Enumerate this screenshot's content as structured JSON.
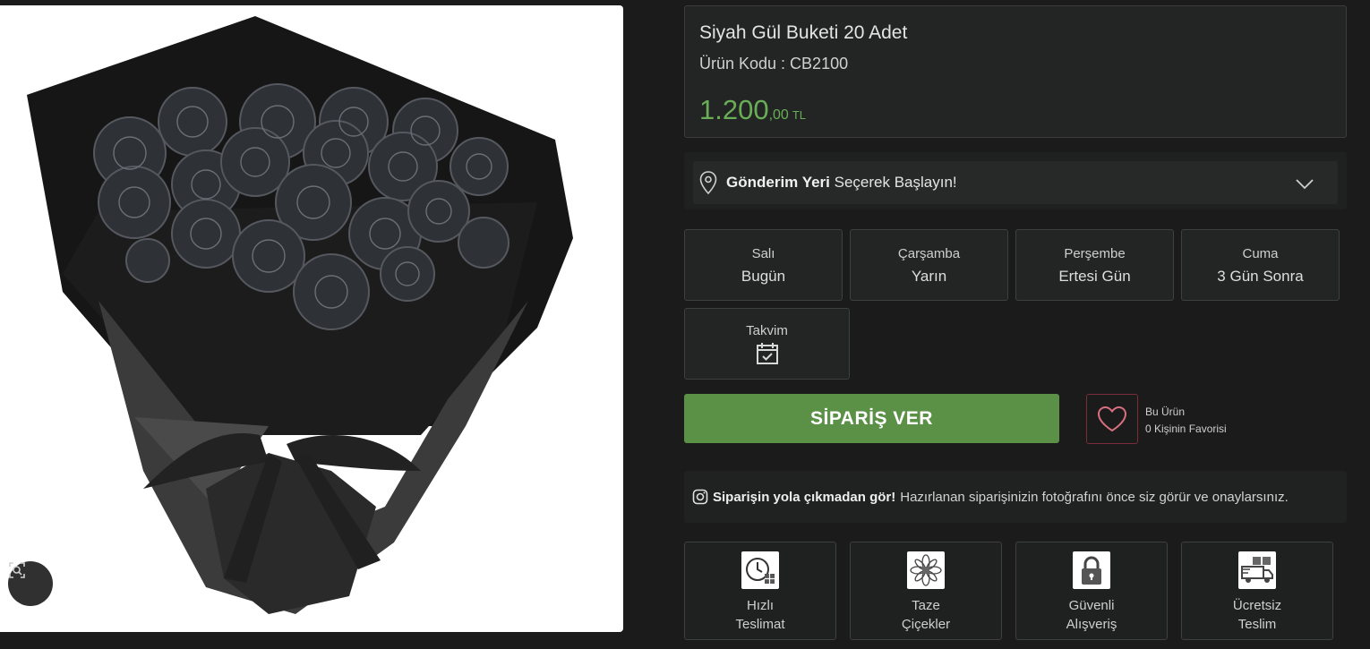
{
  "product": {
    "title": "Siyah Gül Buketi 20 Adet",
    "code_line": "Ürün Kodu : CB2100",
    "price_int": "1.200",
    "price_dec": ",00",
    "currency": "TL",
    "price_color": "#6aad57"
  },
  "image": {
    "alt": "Siyah Gül Buketi",
    "zoom_icon": "zoom-scan-icon"
  },
  "location": {
    "bold": "Gönderim Yeri",
    "rest": " Seçerek Başlayın!",
    "icon": "map-pin-icon"
  },
  "delivery_days": [
    {
      "day": "Salı",
      "label": "Bugün"
    },
    {
      "day": "Çarşamba",
      "label": "Yarın"
    },
    {
      "day": "Perşembe",
      "label": "Ertesi Gün"
    },
    {
      "day": "Cuma",
      "label": "3 Gün Sonra"
    }
  ],
  "calendar": {
    "label": "Takvim",
    "icon": "calendar-check-icon"
  },
  "order_button": "SİPARİŞ VER",
  "favorite": {
    "line1": "Bu Ürün",
    "line2": "0 Kişinin Favorisi",
    "icon": "heart-icon"
  },
  "photo_note": {
    "bold": "Siparişin yola çıkmadan gör!",
    "rest": "Hazırlanan siparişinizin fotoğrafını önce siz görür ve onaylarsınız.",
    "icon": "camera-icon"
  },
  "features": [
    {
      "line1": "Hızlı",
      "line2": "Teslimat",
      "icon": "clock-gift-icon"
    },
    {
      "line1": "Taze",
      "line2": "Çiçekler",
      "icon": "flower-icon"
    },
    {
      "line1": "Güvenli",
      "line2": "Alışveriş",
      "icon": "padlock-icon"
    },
    {
      "line1": "Ücretsiz",
      "line2": "Teslim",
      "icon": "delivery-truck-icon"
    }
  ],
  "colors": {
    "background": "#1a1b1a",
    "accent_green": "#5a9146",
    "favorite_border": "#7a2d3b"
  }
}
